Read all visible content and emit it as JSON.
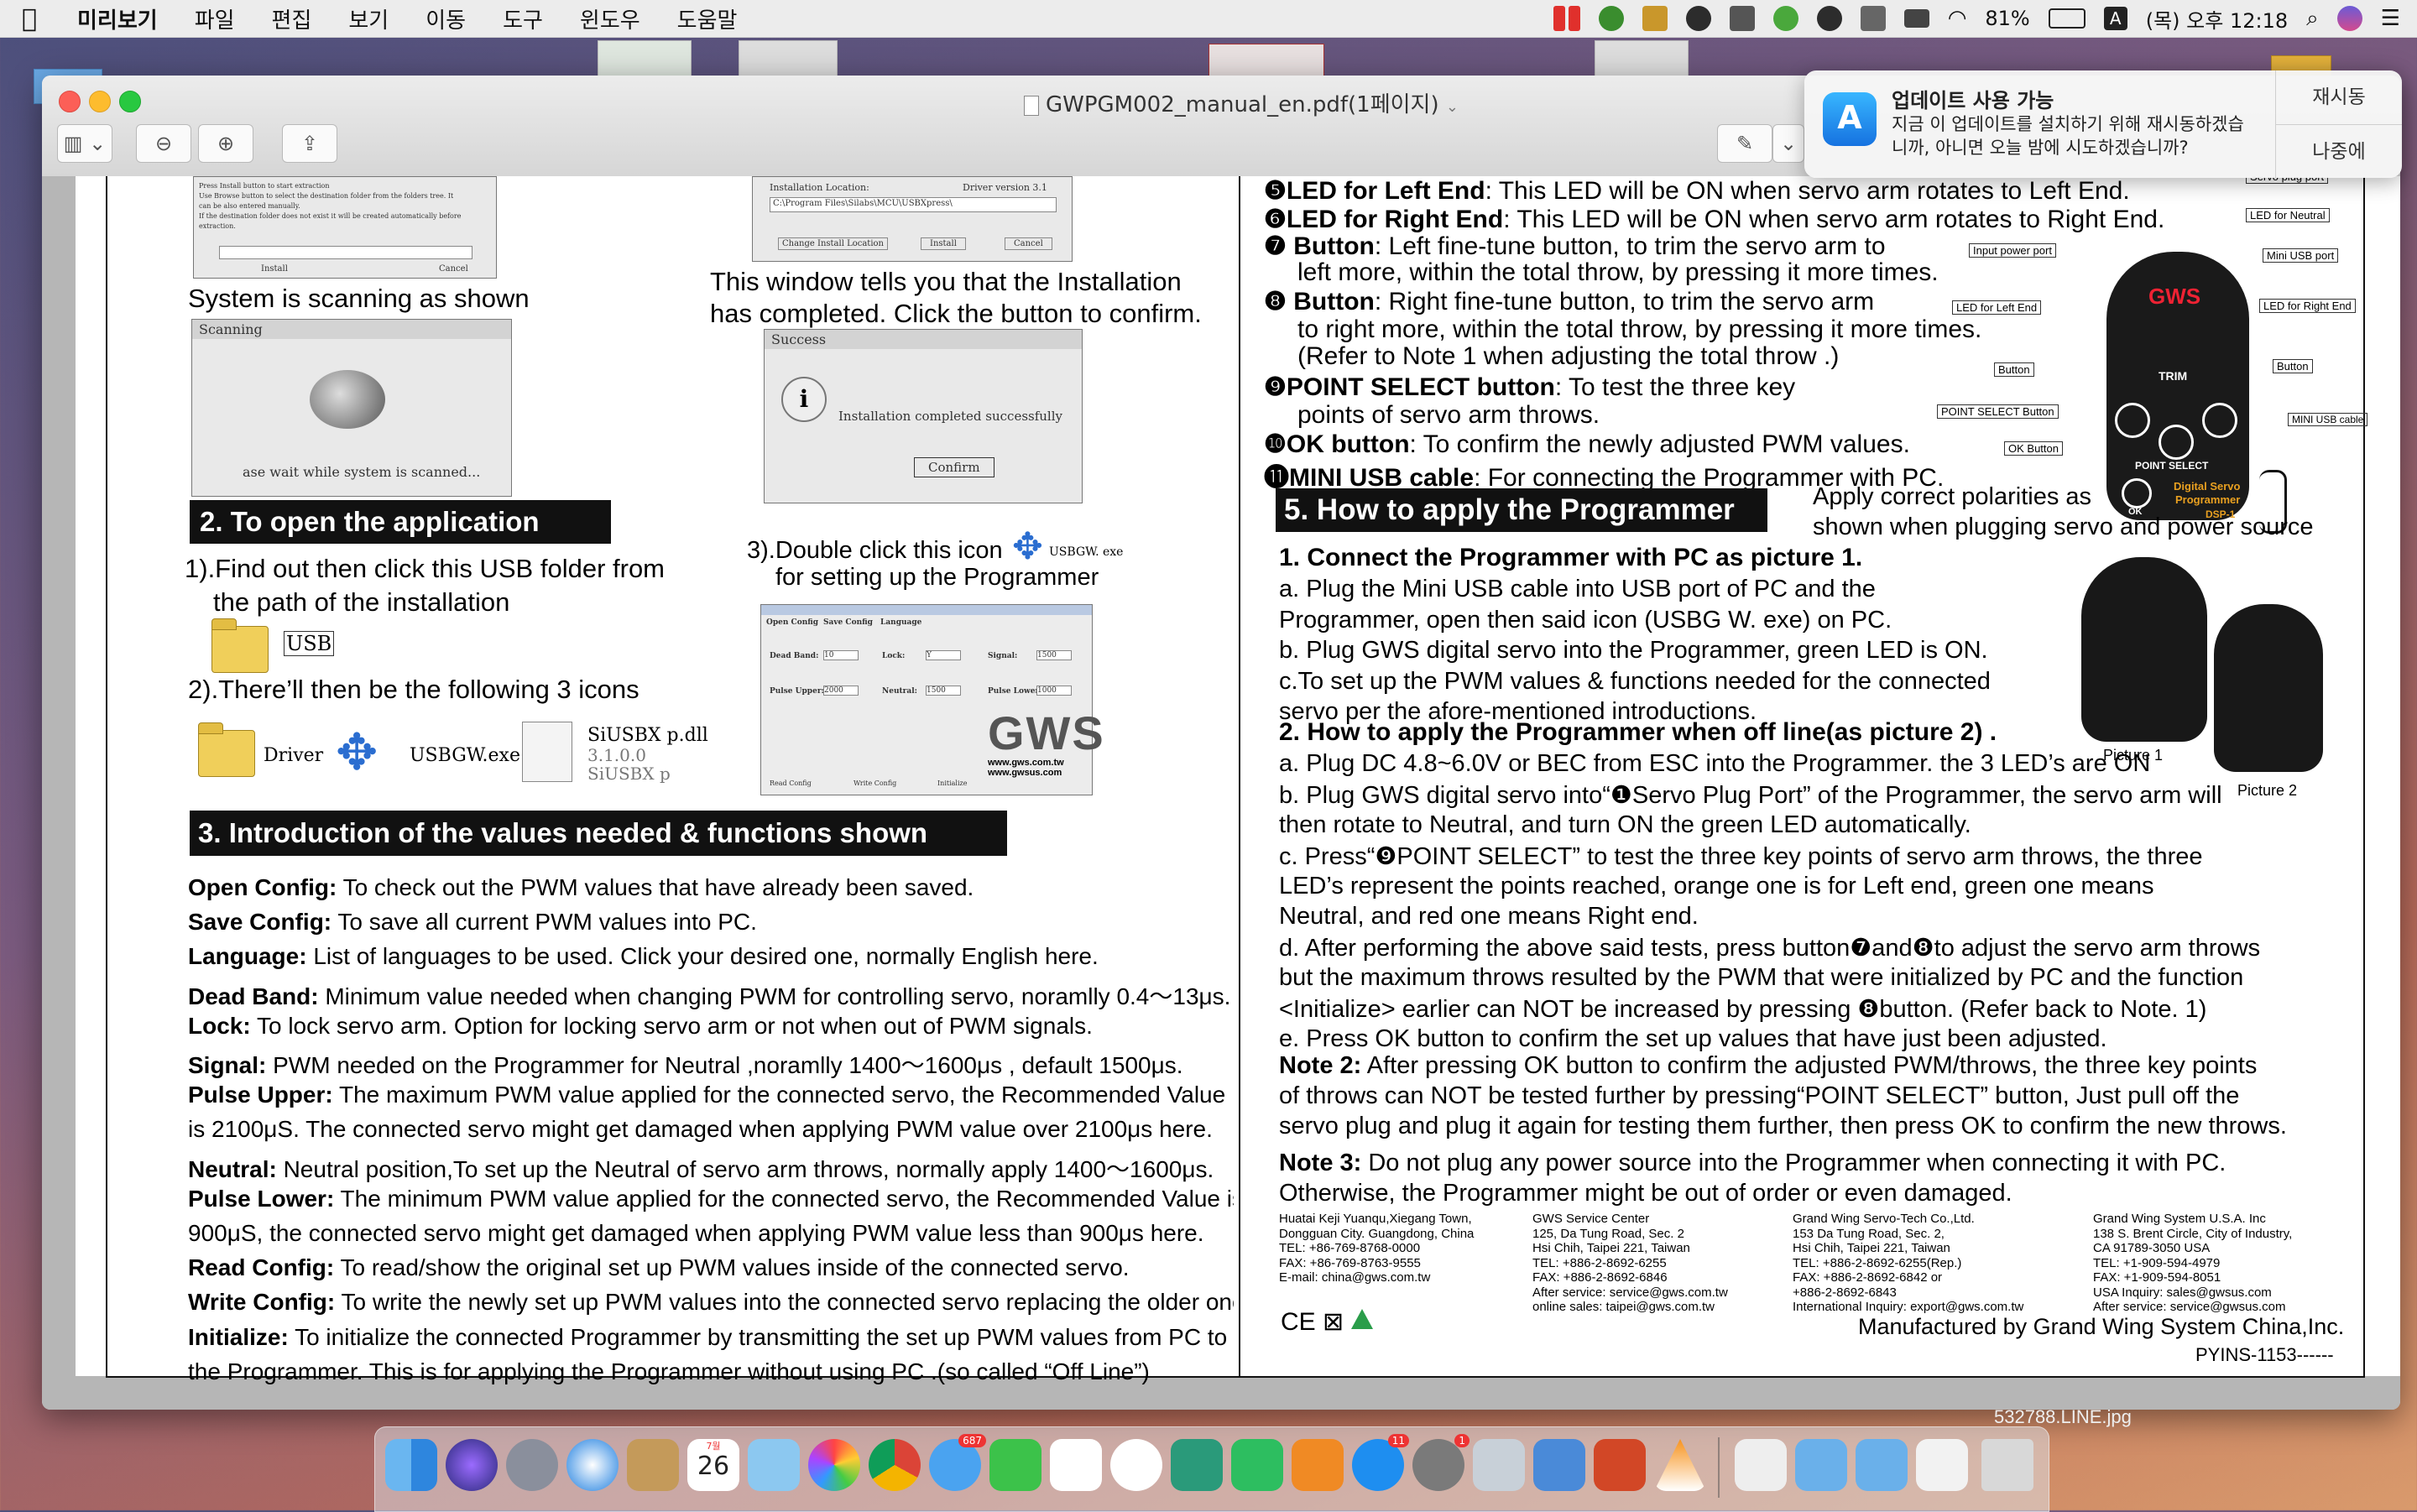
{
  "menubar": {
    "app_name": "미리보기",
    "items": [
      "파일",
      "편집",
      "보기",
      "이동",
      "도구",
      "윈도우",
      "도움말"
    ],
    "battery": "81%",
    "input_source": "A",
    "clock": "(목) 오후 12:18"
  },
  "window": {
    "title": "GWPGM002_manual_en.pdf(1페이지)"
  },
  "notification": {
    "title": "업데이트 사용 가능",
    "body_line1": "지금 이 업데이트를 설치하기 위해 재시동하겠습",
    "body_line2": "니까, 아니면 오늘 밤에 시도하겠습니까?",
    "restart_button": "재시동",
    "later_button": "나중에"
  },
  "page_left": {
    "dialog1_text1": "Press Install button to start extraction",
    "dialog1_text2": "Use Browse button to select the destination folder from the folders tree. It",
    "dialog1_text3": "can be also entered manually.",
    "dialog1_text4": "If the destination folder does not exist it will be created automatically before",
    "dialog1_text5": "extraction.",
    "dialog1_install": "Install",
    "dialog1_cancel": "Cancel",
    "dialog2_label": "Installation Location:",
    "dialog2_version": "Driver version 3.1",
    "dialog2_path": "C:\\Program Files\\Silabs\\MCU\\USBXpress\\",
    "dialog2_change": "Change Install Location",
    "dialog2_install": "Install",
    "dialog2_cancel": "Cancel",
    "scanning_caption": "System is scanning as shown",
    "scanning_title": "Scanning",
    "scanning_text": "ase wait while system is scanned...",
    "installed_line1": "This window tells you that the Installation",
    "installed_line2": "has completed. Click the button to confirm.",
    "success_title": "Success",
    "success_text": "Installation completed successfully",
    "success_confirm": "Confirm",
    "section2_title": "2. To open the application",
    "step1_line1": "1).Find out then click this USB folder from",
    "step1_line2": "the path of the installation",
    "usb_folder": "USB",
    "step2": "2).There’ll then be the following 3 icons",
    "icon_driver": "Driver",
    "icon_usbgw": "USBGW.exe",
    "icon_siusbx1": "SiUSBX p.dll",
    "icon_siusbx2": "3.1.0.0",
    "icon_siusbx3": "SiUSBX p",
    "step3_line1": "3).Double click this icon",
    "step3_icon": "USBGW. exe",
    "step3_line2": "for setting up the Programmer",
    "app_tabs": [
      "Open Config",
      "Save Config",
      "Language"
    ],
    "app_dead_band": "Dead Band:",
    "app_dead_band_val": "10",
    "app_lock": "Lock:",
    "app_lock_val": "Y",
    "app_signal": "Signal:",
    "app_signal_val": "1500",
    "app_pulse_upper": "Pulse Upper:",
    "app_pulse_upper_val": "2000",
    "app_neutral": "Neutral:",
    "app_neutral_val": "1500",
    "app_pulse_lower": "Pulse Lower:",
    "app_pulse_lower_val": "1000",
    "app_logo": "GWS",
    "app_url1": "www.gws.com.tw",
    "app_url2": "www.gwsus.com",
    "app_bottom_btns": [
      "Read Config",
      "Write Config",
      "Initialize"
    ],
    "section3_title": "3. Introduction of the values needed & functions shown",
    "defs": [
      {
        "k": "Open Config:",
        "v": " To check out the PWM values that have already been saved."
      },
      {
        "k": "Save Config:",
        "v": " To save all current PWM values into PC."
      },
      {
        "k": "Language:",
        "v": " List of languages to be used. Click your desired one, normally English here."
      },
      {
        "k": "Dead Band:",
        "v": " Minimum value needed when changing PWM for controlling servo, noramlly 0.4～13μs."
      },
      {
        "k": "Lock:",
        "v": " To lock servo arm.  Option for locking servo arm or not when out of PWM signals."
      },
      {
        "k": "Signal:",
        "v": " PWM needed on the Programmer for Neutral ,noramlly 1400～1600μs ,  default 1500μs."
      },
      {
        "k": "Pulse Upper:",
        "v": " The maximum PWM value applied for the connected servo, the Recommended Value"
      },
      {
        "k": "",
        "v": "is 2100μS. The connected servo might get damaged when applying PWM value over 2100μs here."
      },
      {
        "k": "Neutral:",
        "v": " Neutral position,To set up the Neutral  of servo arm throws, normally apply 1400～1600μs."
      },
      {
        "k": "Pulse Lower:",
        "v": " The minimum PWM value applied for the connected servo, the Recommended Value is"
      },
      {
        "k": "",
        "v": "900μS, the connected servo might get damaged when applying PWM  value less than 900μs here."
      },
      {
        "k": "Read Config:",
        "v": " To read/show the original set up PWM values inside of the connected servo."
      },
      {
        "k": "Write Config:",
        "v": " To write the newly set up PWM values into the connected servo replacing the older ones."
      },
      {
        "k": "Initialize:",
        "v": " To initialize the connected Programmer by transmitting the set up PWM values from PC to"
      },
      {
        "k": "",
        "v": "the Programmer. This is for applying the Programmer without using PC .(so called “Off Line”)"
      }
    ]
  },
  "page_right": {
    "items": [
      {
        "n": "❺",
        "k": "LED for Left End",
        "v": ": This LED will be ON when servo arm rotates to Left End."
      },
      {
        "n": "❻",
        "k": "LED for Right End",
        "v": ": This LED will be ON when servo arm rotates to Right End."
      },
      {
        "n": "❼",
        "k": " Button",
        "v": ": Left fine-tune button, to trim the servo arm to"
      },
      {
        "n": "",
        "k": "",
        "v": "left more, within the total throw, by pressing it more times."
      },
      {
        "n": "❽",
        "k": " Button",
        "v": ": Right fine-tune button, to trim the servo arm"
      },
      {
        "n": "",
        "k": "",
        "v": "to right more, within the total throw, by pressing it more times."
      },
      {
        "n": "",
        "k": "",
        "v": " (Refer to Note 1 when adjusting the total throw .)"
      },
      {
        "n": "❾",
        "k": "POINT SELECT button",
        "v": ": To test the three key"
      },
      {
        "n": "",
        "k": "",
        "v": "points of servo arm throws."
      },
      {
        "n": "❿",
        "k": "OK button",
        "v": ": To confirm the newly adjusted PWM values."
      },
      {
        "n": "⓫",
        "k": "MINI USB cable",
        "v": ": For connecting the Programmer with PC."
      }
    ],
    "diagram_labels": {
      "servo_plug_port": "Servo plug port",
      "led_neutral": "LED for Neutral",
      "input_power_port": "Input power port",
      "mini_usb_port": "Mini USB port",
      "led_left_end": "LED for Left End",
      "led_right_end": "LED for Right End",
      "btn7": "Button",
      "btn8": "Button",
      "point_select_button": "POINT SELECT Button",
      "ok_button": "OK Button",
      "mini_usb_cable": "MINI USB cable",
      "device_logo": "GWS",
      "device_trim": "TRIM",
      "device_point_select": "POINT SELECT",
      "device_ok": "OK",
      "device_name1": "Digital Servo",
      "device_name2": "Programmer",
      "device_model": "DSP-1"
    },
    "section5_title": "5. How to apply the Programmer",
    "section5_note_line1": "Apply correct polarities as",
    "section5_note_line2": "shown when plugging servo and power source",
    "h1": "1. Connect the Programmer with PC as picture 1.",
    "h1_lines": [
      "a. Plug the Mini USB cable into  USB  port of PC and the",
      "    Programmer, open then said icon (USBG W. exe) on PC.",
      "b. Plug GWS digital servo into the Programmer, green LED is ON.",
      "c.To set up the PWM values & functions needed for the connected",
      "    servo per the afore-mentioned introductions."
    ],
    "picture1": "Picture 1",
    "picture2": "Picture 2",
    "h2": "2. How to apply the Programmer when off line(as picture 2) .",
    "h2_lines": [
      "a. Plug DC 4.8~6.0V or BEC from ESC into the Programmer. the 3 LED’s are ON",
      "b. Plug GWS digital servo into“❶Servo Plug Port” of the Programmer, the servo arm will",
      "    then rotate to Neutral, and turn ON the green LED automatically.",
      "c. Press“❾POINT SELECT” to test the three key points of servo arm throws, the three",
      "    LED’s represent the points reached, orange one is for Left end, green one means",
      "    Neutral, and red one means Right end.",
      "d. After performing the above said tests, press button❼and❽to adjust the servo arm  throws",
      "   but the maximum throws resulted by the PWM that were initialized  by PC  and the function",
      "   <Initialize> earlier can NOT be increased by pressing ❽button. (Refer back to Note. 1)",
      "e. Press OK button to confirm the set up values that have just been adjusted."
    ],
    "note2_k": "Note 2:",
    "note2_lines": [
      " After pressing OK button to confirm the adjusted PWM/throws, the three key points",
      "of  throws can NOT be tested further by pressing“POINT SELECT” button, Just pull off the",
      "servo plug and plug it again for testing them further, then press OK to confirm the new throws."
    ],
    "note3_k": "Note 3:",
    "note3_lines": [
      " Do not plug any power source into the Programmer when connecting it with PC.",
      "Otherwise, the Programmer might be out of order or even damaged."
    ],
    "addr_col1": [
      "Huatai Keji Yuanqu,Xiegang Town,",
      "Dongguan City. Guangdong, China",
      "TEL: +86-769-8768-0000",
      "FAX: +86-769-8763-9555",
      "E-mail: china@gws.com.tw"
    ],
    "addr_col2": [
      "GWS Service Center",
      "125, Da Tung Road, Sec. 2",
      "Hsi Chih, Taipei 221, Taiwan",
      "TEL: +886-2-8692-6255",
      "FAX: +886-2-8692-6846",
      "After service: service@gws.com.tw",
      "online sales: taipei@gws.com.tw"
    ],
    "addr_col3": [
      "Grand Wing Servo-Tech Co.,Ltd.",
      "153 Da Tung Road, Sec. 2,",
      "Hsi Chih, Taipei 221, Taiwan",
      "TEL: +886-2-8692-6255(Rep.)",
      "FAX: +886-2-8692-6842 or",
      "        +886-2-8692-6843",
      "International Inquiry: export@gws.com.tw"
    ],
    "addr_col4": [
      "Grand Wing System U.S.A. Inc",
      "138 S. Brent Circle, City of Industry,",
      "CA 91789-3050 USA",
      "TEL: +1-909-594-4979",
      "FAX: +1-909-594-8051",
      "USA Inquiry: sales@gwsus.com",
      "After service: service@gwsus.com"
    ],
    "cert_marks": "CE ⊠",
    "manufactured": "Manufactured by Grand Wing System China,Inc.",
    "code": "PYINS-1153------"
  },
  "desktop": {
    "file_label": "532788.LINE.jpg"
  },
  "dock": {
    "calendar_day": "26",
    "calendar_month": "7월",
    "messages_badge": "687",
    "appstore_badge": "11",
    "prefs_badge": "1"
  }
}
